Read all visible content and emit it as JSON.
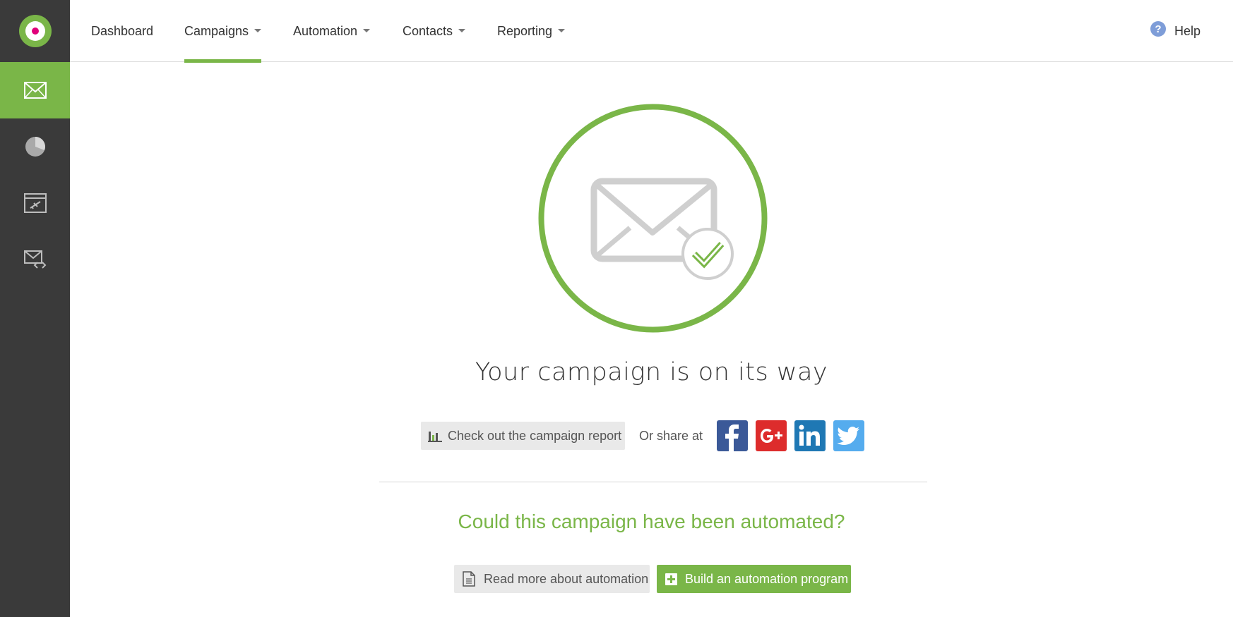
{
  "nav": {
    "items": [
      {
        "label": "Dashboard",
        "dropdown": false,
        "active": false
      },
      {
        "label": "Campaigns",
        "dropdown": true,
        "active": true
      },
      {
        "label": "Automation",
        "dropdown": true,
        "active": false
      },
      {
        "label": "Contacts",
        "dropdown": true,
        "active": false
      },
      {
        "label": "Reporting",
        "dropdown": true,
        "active": false
      }
    ],
    "help_label": "Help"
  },
  "sidebar": {
    "items": [
      {
        "icon": "envelope-icon",
        "active": true
      },
      {
        "icon": "pie-chart-icon",
        "active": false
      },
      {
        "icon": "landing-page-plane-icon",
        "active": false
      },
      {
        "icon": "email-code-icon",
        "active": false
      }
    ]
  },
  "main": {
    "headline": "Your campaign is on its way",
    "report_button_label": "Check out the campaign report",
    "share_text": "Or share at",
    "social": [
      {
        "name": "facebook",
        "color": "#3b5998"
      },
      {
        "name": "google-plus",
        "color": "#dd2c2c"
      },
      {
        "name": "linkedin",
        "color": "#1f78b4"
      },
      {
        "name": "twitter",
        "color": "#55acee"
      }
    ],
    "automation_question": "Could this campaign have been automated?",
    "read_more_label": "Read more about automation",
    "build_label": "Build an automation program"
  },
  "colors": {
    "accent": "#7ab648",
    "sidebar": "#3a3a3a",
    "logo_dot": "#e0007a"
  }
}
